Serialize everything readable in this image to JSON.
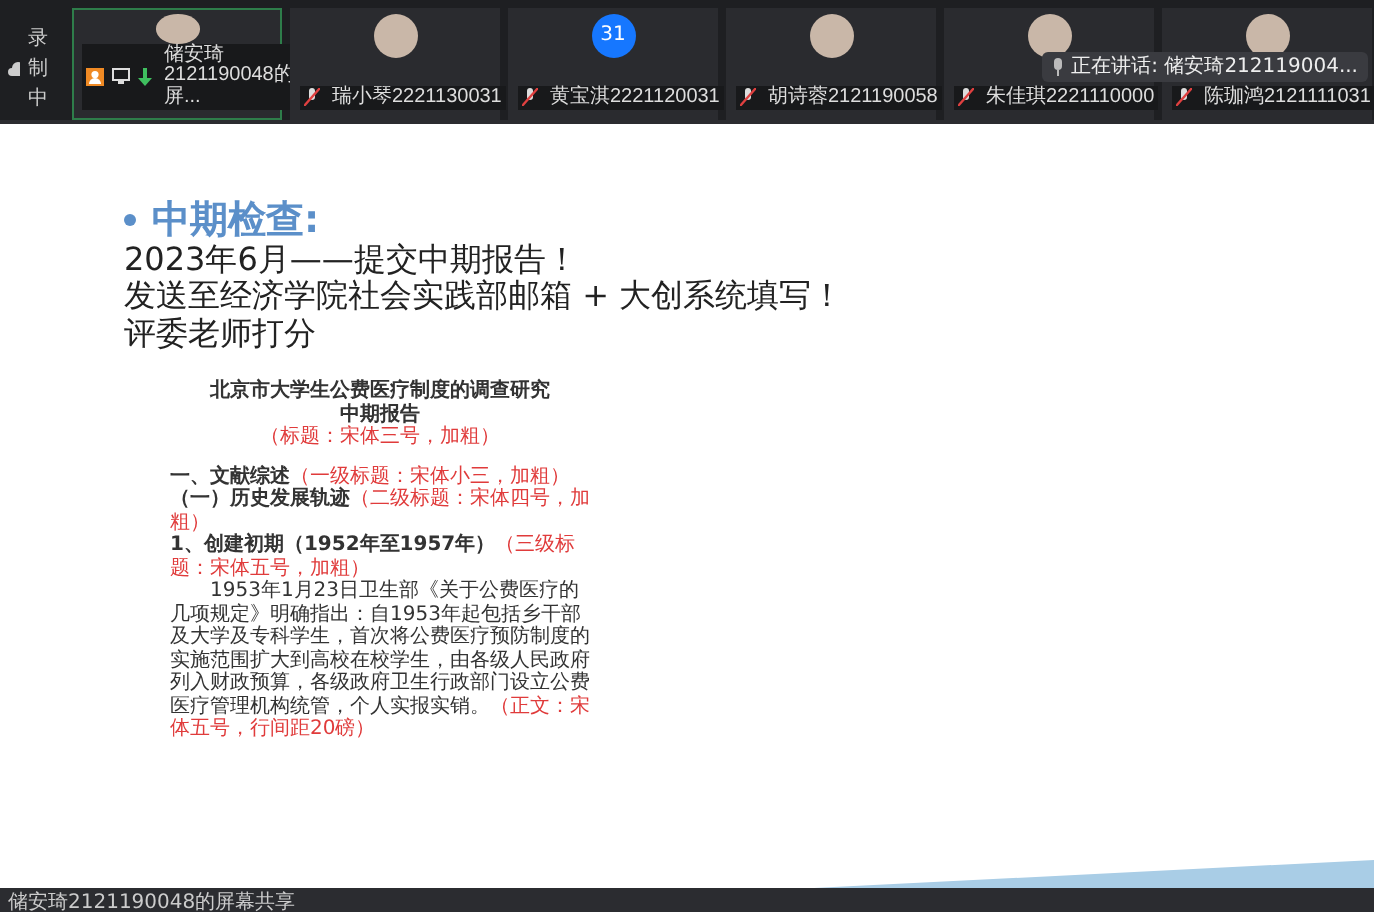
{
  "recording": {
    "label": "录制中"
  },
  "participants": [
    {
      "name": "储安琦2121190048的屏...",
      "sharing_screen": true,
      "highlighted": true
    },
    {
      "name": "瑞小琴2221130031",
      "sharing_screen": false,
      "highlighted": false
    },
    {
      "name": "黄宝淇2221120031",
      "sharing_screen": false,
      "highlighted": false,
      "avatar": "31"
    },
    {
      "name": "胡诗蓉2121190058",
      "sharing_screen": false,
      "highlighted": false
    },
    {
      "name": "朱佳琪2221110000",
      "sharing_screen": false,
      "highlighted": false
    },
    {
      "name": "陈珈鸿2121111031",
      "sharing_screen": false,
      "highlighted": false
    }
  ],
  "speaking": {
    "label": "正在讲话: 储安琦21211900​4..."
  },
  "slide": {
    "heading": "中期检查:",
    "lines": [
      "2023年6月——提交中期报告！",
      "发送至经济学院社会实践部邮箱 + 大创系统填写！",
      "评委老师打分"
    ],
    "document": [
      {
        "kind": "title",
        "text": "北京市大学生公费医疗制度的调查研究"
      },
      {
        "kind": "title",
        "text": "中期报告",
        "note": "（标题：宋体三号，加粗）"
      },
      {
        "kind": "heading",
        "text": "一、文献综述",
        "note": "（一级标题：宋体小三，加粗）"
      },
      {
        "kind": "heading",
        "text": "（一）历史发展轨迹",
        "note": "（二级标题：宋体四号，加粗）"
      },
      {
        "kind": "heading",
        "text": "1、创建初期（1952年至1957年）",
        "note": "（三级标题：宋体五号，加粗）"
      },
      {
        "kind": "body",
        "text": "1953年1月23日卫生部《关于公费医疗的几项规定》明确指出：自1953年起包括乡干部及大学及专科学生，首次将公费医疗预防制度的实施范围扩大到高校在校学生，由各级人民政府列入财政预算，各级政府卫生行政部门设立公费医疗管理机构统管，个人实报实销。",
        "note": "（正文：宋体五号，行间距20磅）"
      }
    ]
  },
  "share_label": "储安琦2121190048的屏幕共享"
}
